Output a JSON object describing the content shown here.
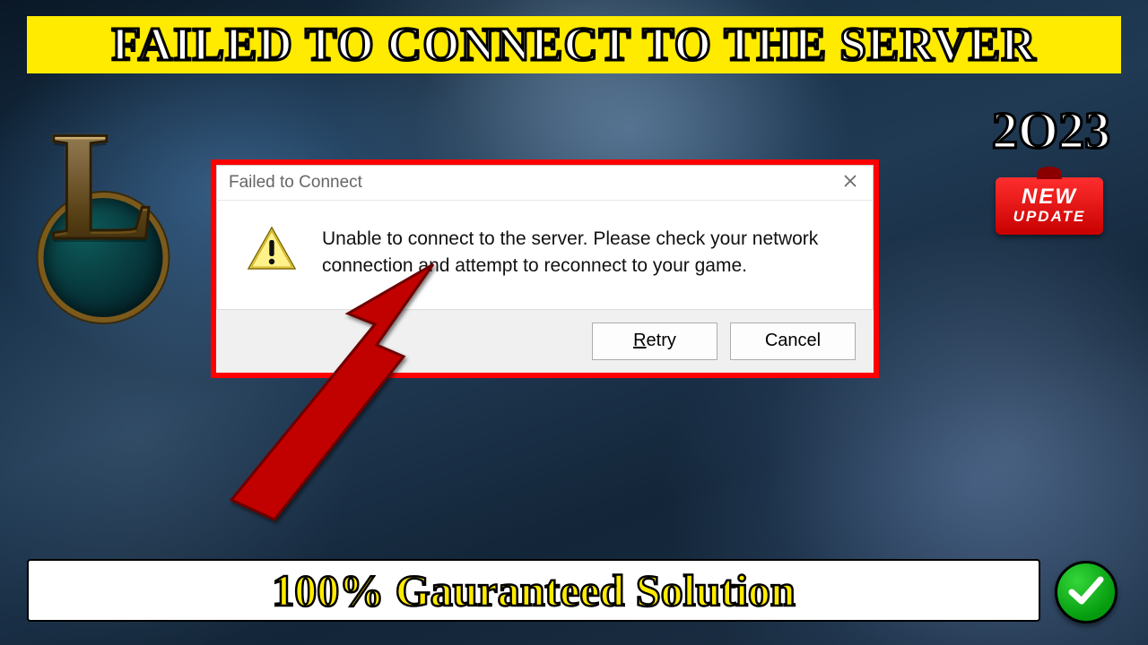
{
  "banner": {
    "top_text": "FAILED TO CONNECT TO THE SERVER",
    "bottom_text": "100% Gauranteed Solution",
    "year": "2O23"
  },
  "badge": {
    "line1": "NEW",
    "line2": "UPDATE"
  },
  "logo": {
    "letter": "L"
  },
  "dialog": {
    "title": "Failed to Connect",
    "message": "Unable to connect to the server. Please check your network connection and attempt to reconnect to your game.",
    "retry_label": "Retry",
    "cancel_label": "Cancel"
  }
}
